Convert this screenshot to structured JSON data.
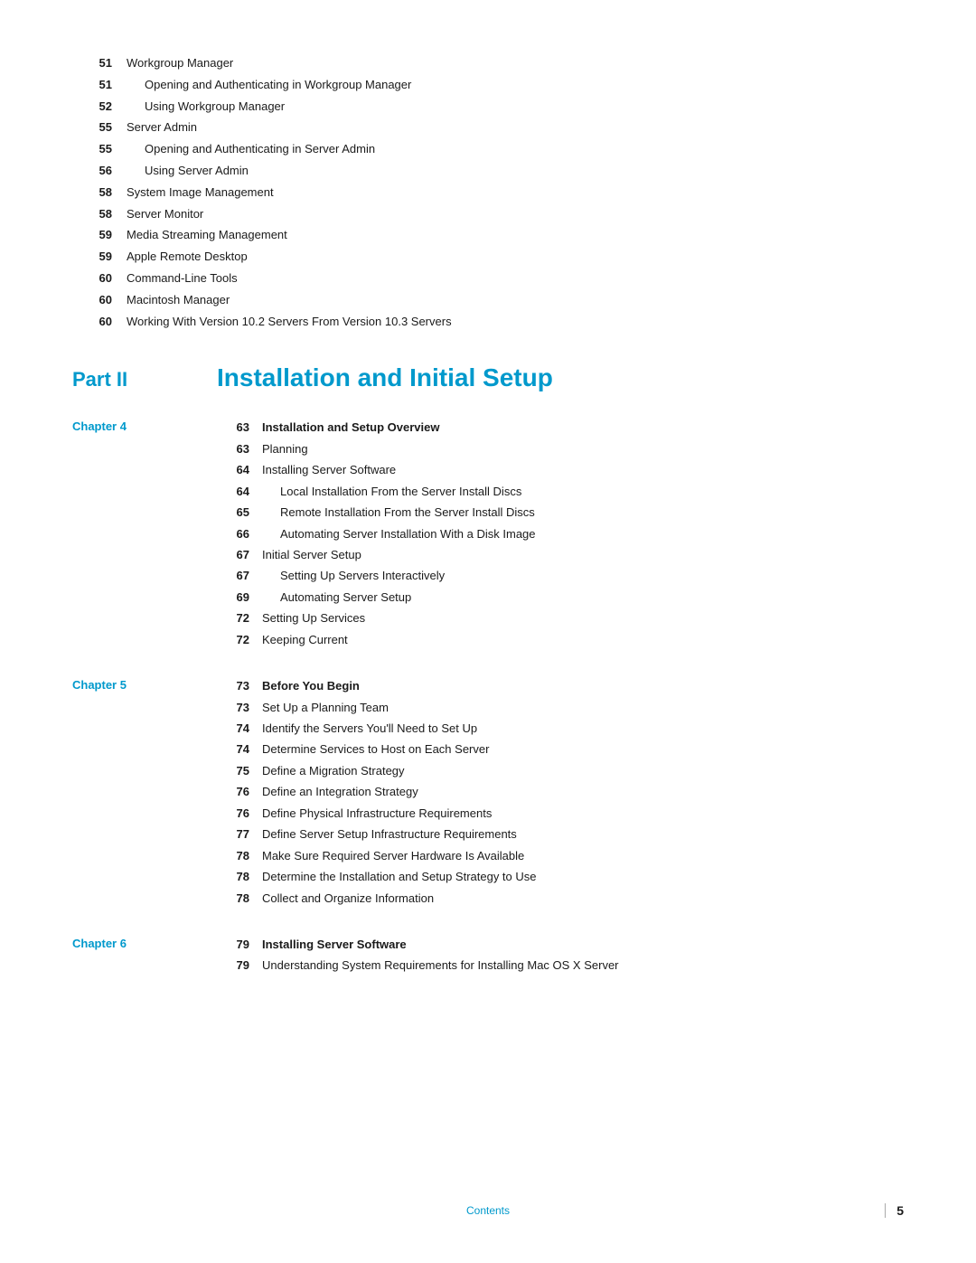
{
  "top_entries": [
    {
      "page": "51",
      "text": "Workgroup Manager",
      "indent": 0,
      "bold": false
    },
    {
      "page": "51",
      "text": "Opening and Authenticating in Workgroup Manager",
      "indent": 1,
      "bold": false
    },
    {
      "page": "52",
      "text": "Using Workgroup Manager",
      "indent": 1,
      "bold": false
    },
    {
      "page": "55",
      "text": "Server Admin",
      "indent": 0,
      "bold": false
    },
    {
      "page": "55",
      "text": "Opening and Authenticating in Server Admin",
      "indent": 1,
      "bold": false
    },
    {
      "page": "56",
      "text": "Using Server Admin",
      "indent": 1,
      "bold": false
    },
    {
      "page": "58",
      "text": "System Image Management",
      "indent": 0,
      "bold": false
    },
    {
      "page": "58",
      "text": "Server Monitor",
      "indent": 0,
      "bold": false
    },
    {
      "page": "59",
      "text": "Media Streaming Management",
      "indent": 0,
      "bold": false
    },
    {
      "page": "59",
      "text": "Apple Remote Desktop",
      "indent": 0,
      "bold": false
    },
    {
      "page": "60",
      "text": "Command-Line Tools",
      "indent": 0,
      "bold": false
    },
    {
      "page": "60",
      "text": "Macintosh Manager",
      "indent": 0,
      "bold": false
    },
    {
      "page": "60",
      "text": "Working With Version 10.2 Servers From Version 10.3 Servers",
      "indent": 0,
      "bold": false
    }
  ],
  "part": {
    "label": "Part II",
    "title": "Installation and Initial Setup"
  },
  "chapters": [
    {
      "label": "Chapter 4",
      "entries": [
        {
          "page": "63",
          "text": "Installation and Setup Overview",
          "bold": true,
          "indent": 0
        },
        {
          "page": "63",
          "text": "Planning",
          "bold": false,
          "indent": 0
        },
        {
          "page": "64",
          "text": "Installing Server Software",
          "bold": false,
          "indent": 0
        },
        {
          "page": "64",
          "text": "Local Installation From the Server Install Discs",
          "bold": false,
          "indent": 1
        },
        {
          "page": "65",
          "text": "Remote Installation From the Server Install Discs",
          "bold": false,
          "indent": 1
        },
        {
          "page": "66",
          "text": "Automating Server Installation With a Disk Image",
          "bold": false,
          "indent": 1
        },
        {
          "page": "67",
          "text": "Initial Server Setup",
          "bold": false,
          "indent": 0
        },
        {
          "page": "67",
          "text": "Setting Up Servers Interactively",
          "bold": false,
          "indent": 1
        },
        {
          "page": "69",
          "text": "Automating Server Setup",
          "bold": false,
          "indent": 1
        },
        {
          "page": "72",
          "text": "Setting Up Services",
          "bold": false,
          "indent": 0
        },
        {
          "page": "72",
          "text": "Keeping Current",
          "bold": false,
          "indent": 0
        }
      ]
    },
    {
      "label": "Chapter 5",
      "entries": [
        {
          "page": "73",
          "text": "Before You Begin",
          "bold": true,
          "indent": 0
        },
        {
          "page": "73",
          "text": "Set Up a Planning Team",
          "bold": false,
          "indent": 0
        },
        {
          "page": "74",
          "text": "Identify the Servers You'll Need to Set Up",
          "bold": false,
          "indent": 0
        },
        {
          "page": "74",
          "text": "Determine Services to Host on Each Server",
          "bold": false,
          "indent": 0
        },
        {
          "page": "75",
          "text": "Define a Migration Strategy",
          "bold": false,
          "indent": 0
        },
        {
          "page": "76",
          "text": "Define an Integration Strategy",
          "bold": false,
          "indent": 0
        },
        {
          "page": "76",
          "text": "Define Physical Infrastructure Requirements",
          "bold": false,
          "indent": 0
        },
        {
          "page": "77",
          "text": "Define Server Setup Infrastructure Requirements",
          "bold": false,
          "indent": 0
        },
        {
          "page": "78",
          "text": "Make Sure Required Server Hardware Is Available",
          "bold": false,
          "indent": 0
        },
        {
          "page": "78",
          "text": "Determine the Installation and Setup Strategy to Use",
          "bold": false,
          "indent": 0
        },
        {
          "page": "78",
          "text": "Collect and Organize Information",
          "bold": false,
          "indent": 0
        }
      ]
    },
    {
      "label": "Chapter 6",
      "entries": [
        {
          "page": "79",
          "text": "Installing Server Software",
          "bold": true,
          "indent": 0
        },
        {
          "page": "79",
          "text": "Understanding System Requirements for Installing Mac OS X Server",
          "bold": false,
          "indent": 0
        }
      ]
    }
  ],
  "footer": {
    "center_text": "Contents",
    "page_number": "5"
  }
}
